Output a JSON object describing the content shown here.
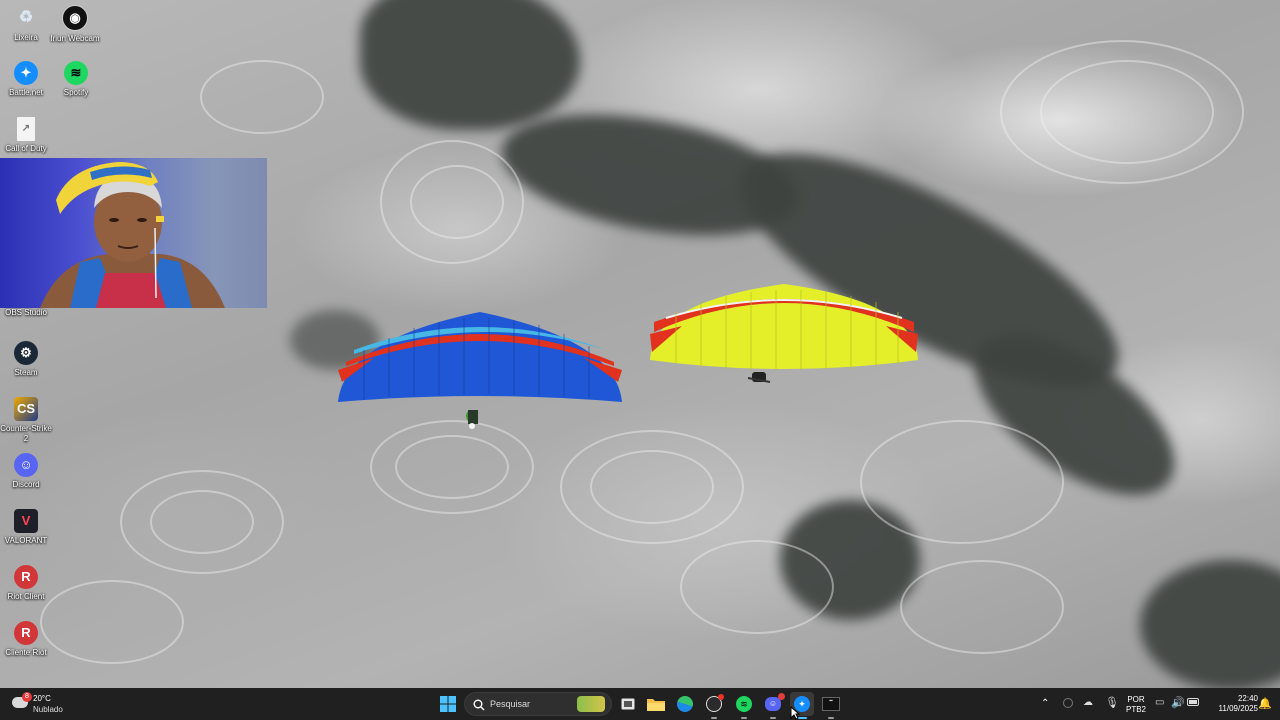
{
  "desktop_icons": [
    {
      "label": "Lixeira",
      "icon": "recycle-bin-icon"
    },
    {
      "label": "Iriun Webcam",
      "icon": "iriun-webcam-icon"
    },
    {
      "label": "Battle.net",
      "icon": "battlenet-icon"
    },
    {
      "label": "Spotify",
      "icon": "spotify-icon"
    },
    {
      "label": "Call of Duty",
      "icon": "document-shortcut-icon"
    },
    {
      "label": "OBS Studio",
      "icon": "obs-studio-icon"
    },
    {
      "label": "Steam",
      "icon": "steam-icon"
    },
    {
      "label": "Counter-Strike 2",
      "icon": "counter-strike-icon"
    },
    {
      "label": "Discord",
      "icon": "discord-icon"
    },
    {
      "label": "VALORANT",
      "icon": "valorant-icon"
    },
    {
      "label": "Riot Client",
      "icon": "riot-client-icon"
    },
    {
      "label": "Cliente Riot",
      "icon": "riot-client-icon"
    }
  ],
  "weather": {
    "temperature": "20°C",
    "condition": "Nublado",
    "badge": "8"
  },
  "search": {
    "placeholder": "Pesquisar"
  },
  "taskbar_apps": [
    "start-icon",
    "search-icon",
    "task-view-icon",
    "file-explorer-icon",
    "edge-icon",
    "obs-icon",
    "spotify-icon",
    "discord-icon",
    "battlenet-icon",
    "call-of-duty-icon"
  ],
  "tray": {
    "language": "POR",
    "layout": "PTB2",
    "time": "22:40",
    "date": "11/09/2025"
  },
  "colors": {
    "taskbar": "#202020",
    "wing_blue": "#1f57d6",
    "wing_yellow": "#e4ef2a",
    "wing_red": "#e0321e"
  }
}
